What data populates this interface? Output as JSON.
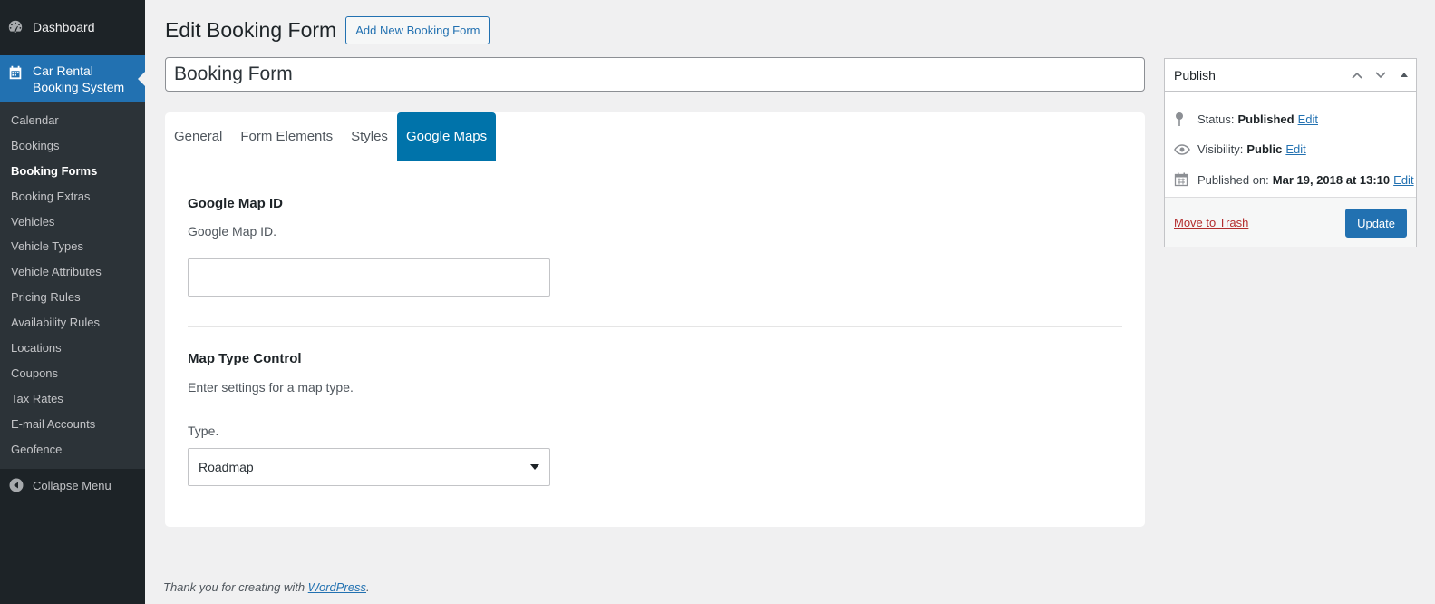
{
  "sidebar": {
    "dashboard": {
      "label": "Dashboard",
      "icon": "dashboard-icon"
    },
    "current": {
      "label_line1": "Car Rental",
      "label_line2": "Booking System",
      "icon": "calendar-icon"
    },
    "submenu": [
      {
        "label": "Calendar"
      },
      {
        "label": "Bookings"
      },
      {
        "label": "Booking Forms",
        "active": true
      },
      {
        "label": "Booking Extras"
      },
      {
        "label": "Vehicles"
      },
      {
        "label": "Vehicle Types"
      },
      {
        "label": "Vehicle Attributes"
      },
      {
        "label": "Pricing Rules"
      },
      {
        "label": "Availability Rules"
      },
      {
        "label": "Locations"
      },
      {
        "label": "Coupons"
      },
      {
        "label": "Tax Rates"
      },
      {
        "label": "E-mail Accounts"
      },
      {
        "label": "Geofence"
      }
    ],
    "collapse": {
      "label": "Collapse Menu",
      "icon": "collapse-arrow-icon"
    }
  },
  "header": {
    "title": "Edit Booking Form",
    "add_new_label": "Add New Booking Form"
  },
  "post_title": {
    "value": "Booking Form"
  },
  "tabs": [
    {
      "label": "General"
    },
    {
      "label": "Form Elements"
    },
    {
      "label": "Styles"
    },
    {
      "label": "Google Maps",
      "active": true
    }
  ],
  "google_map_id": {
    "title": "Google Map ID",
    "description": "Google Map ID.",
    "value": ""
  },
  "map_type_control": {
    "title": "Map Type Control",
    "description": "Enter settings for a map type.",
    "type_label": "Type.",
    "type_selected": "Roadmap"
  },
  "publish": {
    "title": "Publish",
    "status_label": "Status:",
    "status_value": "Published",
    "visibility_label": "Visibility:",
    "visibility_value": "Public",
    "published_on_label": "Published on:",
    "published_on_value": "Mar 19, 2018 at 13:10",
    "edit_label": "Edit",
    "trash_label": "Move to Trash",
    "update_label": "Update"
  },
  "footer": {
    "text": "Thank you for creating with",
    "link": "WordPress",
    "period": "."
  },
  "colors": {
    "sidebar_bg": "#1d2327",
    "sidebar_submenu_bg": "#2c3338",
    "accent": "#2271b1",
    "tab_active": "#0073aa",
    "trash": "#b32d2e"
  }
}
